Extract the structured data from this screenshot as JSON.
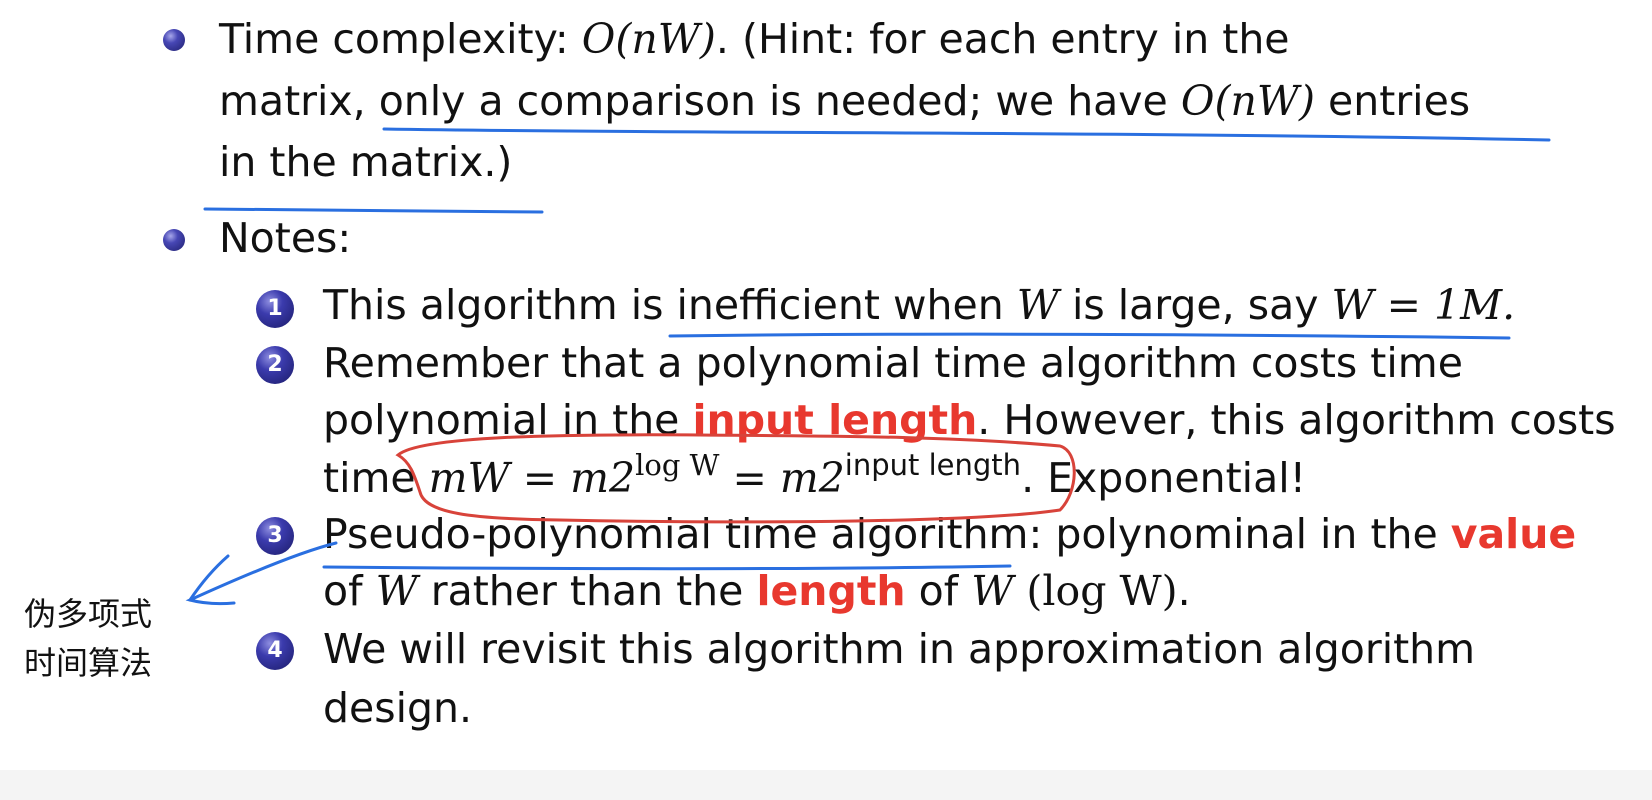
{
  "bullets": [
    {
      "line1_a": "Time complexity:  ",
      "line1_math_o": "O",
      "line1_math_args": "(nW)",
      "line1_b": ".  (Hint:  for each entry in the",
      "line2_a": "matrix,  only a comparison is needed;  we have ",
      "line2_math_o": "O",
      "line2_math_args": "(nW)",
      "line2_b": " entries",
      "line3": "in the matrix.)"
    },
    {
      "label": "Notes:"
    }
  ],
  "notes": [
    {
      "number": "1",
      "text_a": "This algorithm is inefficient when ",
      "math_w": "W",
      "text_b": " is large,  say ",
      "math_eq": "W = 1M."
    },
    {
      "number": "2",
      "line1": "Remember that a polynomial time algorithm costs time",
      "line2_a": "polynomial in the ",
      "line2_red": "input length",
      "line2_b": ".  However,  this algorithm costs",
      "line3_a": "time ",
      "line3_m1": "mW = m2",
      "line3_sup1": "log W",
      "line3_m2": " = m2",
      "line3_sup2": "input length",
      "line3_b": ".  Exponential!"
    },
    {
      "number": "3",
      "line1_a": "Pseudo-polynomial time algorithm:  polynominal in the ",
      "line1_red": "value",
      "line2_a": "of ",
      "line2_w": "W",
      "line2_b": " rather than the ",
      "line2_red": "length",
      "line2_c": " of ",
      "line2_w2": "W",
      "line2_math": " (log W)",
      "line2_end": "."
    },
    {
      "number": "4",
      "line1": "We will revisit this algorithm in approximation algorithm",
      "line2": "design."
    }
  ],
  "annotation": {
    "line1": "伪多项式",
    "line2": "时间算法"
  },
  "colors": {
    "accent_red": "#e8382e",
    "ink_blue": "#2a6fe0",
    "ink_red": "#d8433a",
    "bullet_navy": "#2c2c8c"
  }
}
